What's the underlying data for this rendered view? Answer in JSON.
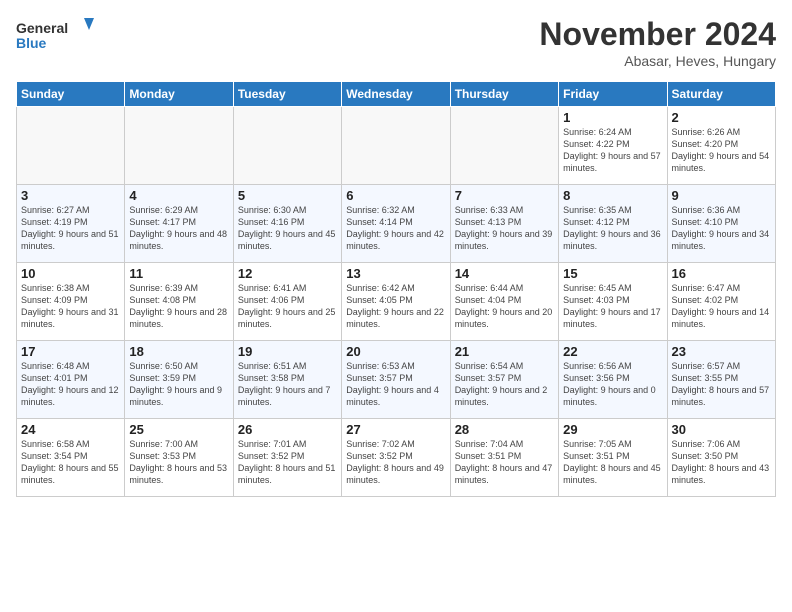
{
  "header": {
    "logo_line1": "General",
    "logo_line2": "Blue",
    "month": "November 2024",
    "location": "Abasar, Heves, Hungary"
  },
  "weekdays": [
    "Sunday",
    "Monday",
    "Tuesday",
    "Wednesday",
    "Thursday",
    "Friday",
    "Saturday"
  ],
  "weeks": [
    [
      {
        "day": "",
        "empty": true
      },
      {
        "day": "",
        "empty": true
      },
      {
        "day": "",
        "empty": true
      },
      {
        "day": "",
        "empty": true
      },
      {
        "day": "",
        "empty": true
      },
      {
        "day": "1",
        "sunrise": "6:24 AM",
        "sunset": "4:22 PM",
        "daylight": "9 hours and 57 minutes."
      },
      {
        "day": "2",
        "sunrise": "6:26 AM",
        "sunset": "4:20 PM",
        "daylight": "9 hours and 54 minutes."
      }
    ],
    [
      {
        "day": "3",
        "sunrise": "6:27 AM",
        "sunset": "4:19 PM",
        "daylight": "9 hours and 51 minutes."
      },
      {
        "day": "4",
        "sunrise": "6:29 AM",
        "sunset": "4:17 PM",
        "daylight": "9 hours and 48 minutes."
      },
      {
        "day": "5",
        "sunrise": "6:30 AM",
        "sunset": "4:16 PM",
        "daylight": "9 hours and 45 minutes."
      },
      {
        "day": "6",
        "sunrise": "6:32 AM",
        "sunset": "4:14 PM",
        "daylight": "9 hours and 42 minutes."
      },
      {
        "day": "7",
        "sunrise": "6:33 AM",
        "sunset": "4:13 PM",
        "daylight": "9 hours and 39 minutes."
      },
      {
        "day": "8",
        "sunrise": "6:35 AM",
        "sunset": "4:12 PM",
        "daylight": "9 hours and 36 minutes."
      },
      {
        "day": "9",
        "sunrise": "6:36 AM",
        "sunset": "4:10 PM",
        "daylight": "9 hours and 34 minutes."
      }
    ],
    [
      {
        "day": "10",
        "sunrise": "6:38 AM",
        "sunset": "4:09 PM",
        "daylight": "9 hours and 31 minutes."
      },
      {
        "day": "11",
        "sunrise": "6:39 AM",
        "sunset": "4:08 PM",
        "daylight": "9 hours and 28 minutes."
      },
      {
        "day": "12",
        "sunrise": "6:41 AM",
        "sunset": "4:06 PM",
        "daylight": "9 hours and 25 minutes."
      },
      {
        "day": "13",
        "sunrise": "6:42 AM",
        "sunset": "4:05 PM",
        "daylight": "9 hours and 22 minutes."
      },
      {
        "day": "14",
        "sunrise": "6:44 AM",
        "sunset": "4:04 PM",
        "daylight": "9 hours and 20 minutes."
      },
      {
        "day": "15",
        "sunrise": "6:45 AM",
        "sunset": "4:03 PM",
        "daylight": "9 hours and 17 minutes."
      },
      {
        "day": "16",
        "sunrise": "6:47 AM",
        "sunset": "4:02 PM",
        "daylight": "9 hours and 14 minutes."
      }
    ],
    [
      {
        "day": "17",
        "sunrise": "6:48 AM",
        "sunset": "4:01 PM",
        "daylight": "9 hours and 12 minutes."
      },
      {
        "day": "18",
        "sunrise": "6:50 AM",
        "sunset": "3:59 PM",
        "daylight": "9 hours and 9 minutes."
      },
      {
        "day": "19",
        "sunrise": "6:51 AM",
        "sunset": "3:58 PM",
        "daylight": "9 hours and 7 minutes."
      },
      {
        "day": "20",
        "sunrise": "6:53 AM",
        "sunset": "3:57 PM",
        "daylight": "9 hours and 4 minutes."
      },
      {
        "day": "21",
        "sunrise": "6:54 AM",
        "sunset": "3:57 PM",
        "daylight": "9 hours and 2 minutes."
      },
      {
        "day": "22",
        "sunrise": "6:56 AM",
        "sunset": "3:56 PM",
        "daylight": "9 hours and 0 minutes."
      },
      {
        "day": "23",
        "sunrise": "6:57 AM",
        "sunset": "3:55 PM",
        "daylight": "8 hours and 57 minutes."
      }
    ],
    [
      {
        "day": "24",
        "sunrise": "6:58 AM",
        "sunset": "3:54 PM",
        "daylight": "8 hours and 55 minutes."
      },
      {
        "day": "25",
        "sunrise": "7:00 AM",
        "sunset": "3:53 PM",
        "daylight": "8 hours and 53 minutes."
      },
      {
        "day": "26",
        "sunrise": "7:01 AM",
        "sunset": "3:52 PM",
        "daylight": "8 hours and 51 minutes."
      },
      {
        "day": "27",
        "sunrise": "7:02 AM",
        "sunset": "3:52 PM",
        "daylight": "8 hours and 49 minutes."
      },
      {
        "day": "28",
        "sunrise": "7:04 AM",
        "sunset": "3:51 PM",
        "daylight": "8 hours and 47 minutes."
      },
      {
        "day": "29",
        "sunrise": "7:05 AM",
        "sunset": "3:51 PM",
        "daylight": "8 hours and 45 minutes."
      },
      {
        "day": "30",
        "sunrise": "7:06 AM",
        "sunset": "3:50 PM",
        "daylight": "8 hours and 43 minutes."
      }
    ]
  ]
}
